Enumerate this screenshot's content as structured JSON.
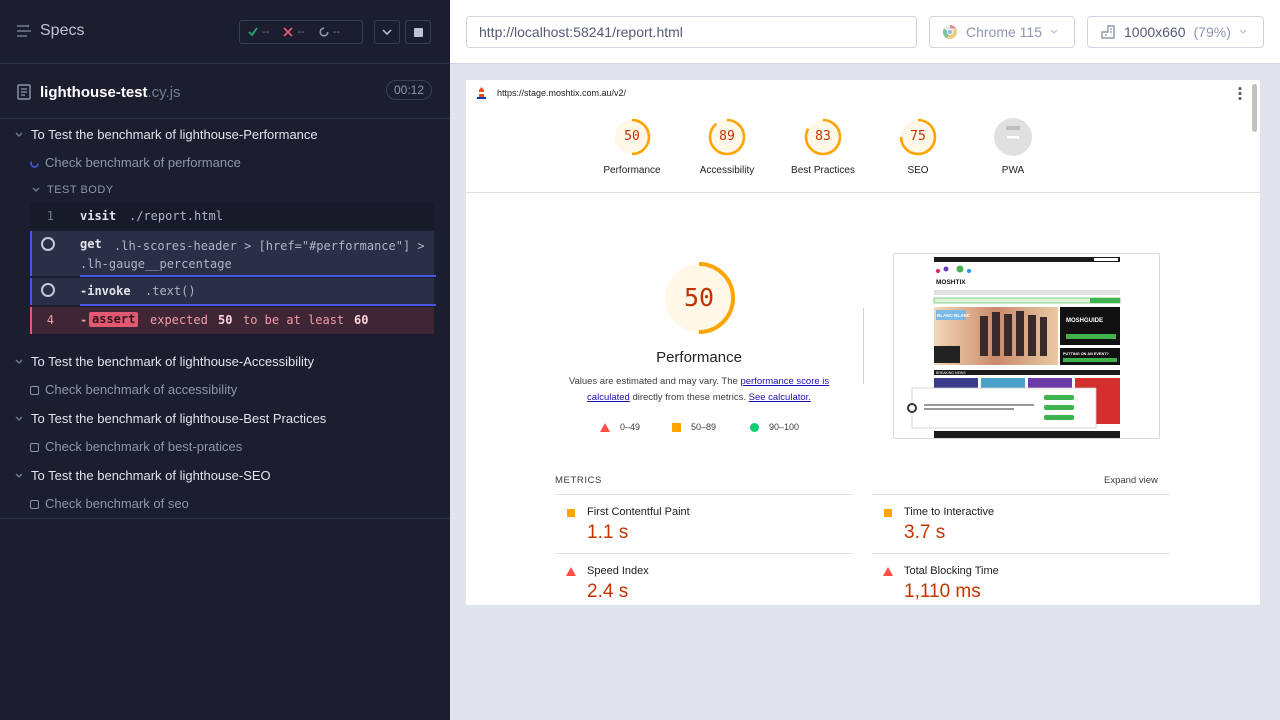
{
  "runner": {
    "specs_label": "Specs",
    "stats": {
      "passed": "--",
      "failed": "--",
      "pending": "--"
    },
    "file": {
      "name": "lighthouse-test",
      "ext": ".cy.js",
      "duration": "00:12"
    },
    "suites": [
      {
        "title": "To Test the benchmark of lighthouse-Performance",
        "test": "Check benchmark of performance",
        "test_body_label": "TEST BODY",
        "commands": [
          {
            "num": "1",
            "name": "visit",
            "arg": "./report.html"
          },
          {
            "name": "get",
            "arg": ".lh-scores-header > [href=\"#performance\"] > .lh-gauge__percentage"
          },
          {
            "name": "-invoke",
            "arg": ".text()"
          },
          {
            "num": "4",
            "prefix": "-",
            "name": "assert",
            "msg": [
              "expected",
              "50",
              "to be at least",
              "60"
            ]
          }
        ]
      },
      {
        "title": "To Test the benchmark of lighthouse-Accessibility",
        "test": "Check benchmark of accessibility"
      },
      {
        "title": "To Test the benchmark of lighthouse-Best Practices",
        "test": "Check benchmark of best-pratices"
      },
      {
        "title": "To Test the benchmark of lighthouse-SEO",
        "test": "Check benchmark of seo"
      }
    ]
  },
  "toolbar": {
    "url": "http://localhost:58241/report.html",
    "browser": "Chrome 115",
    "viewport": "1000x660",
    "scale": "(79%)"
  },
  "report": {
    "page_url": "https://stage.moshtix.com.au/v2/",
    "scores": [
      {
        "label": "Performance",
        "value": "50",
        "color": "#ffa400",
        "fraction": 0.5
      },
      {
        "label": "Accessibility",
        "value": "89",
        "color": "#ffa400",
        "fraction": 0.89
      },
      {
        "label": "Best Practices",
        "value": "83",
        "color": "#ffa400",
        "fraction": 0.83
      },
      {
        "label": "SEO",
        "value": "75",
        "color": "#ffa400",
        "fraction": 0.75
      },
      {
        "label": "PWA",
        "value": "",
        "color": "#cccccc",
        "fraction": 0
      }
    ],
    "perf": {
      "value": "50",
      "title": "Performance",
      "desc_1": "Values are estimated and may vary. The ",
      "desc_link_1": "performance score is calculated",
      "desc_2": " directly from these metrics. ",
      "desc_link_2": "See calculator.",
      "legend": [
        "0–49",
        "50–89",
        "90–100"
      ]
    },
    "metrics_label": "METRICS",
    "expand_label": "Expand view",
    "metrics": [
      {
        "title": "First Contentful Paint",
        "value": "1.1 s",
        "rating": "average"
      },
      {
        "title": "Time to Interactive",
        "value": "3.7 s",
        "rating": "average"
      },
      {
        "title": "Speed Index",
        "value": "2.4 s",
        "rating": "fail"
      },
      {
        "title": "Total Blocking Time",
        "value": "1,110 ms",
        "rating": "fail"
      }
    ],
    "thumb": {
      "brand": "MOSHTIX",
      "promo": "MOSHGUIDE",
      "promo2": "PUTTING ON AN EVENT?",
      "section": "BREAKING NEWS",
      "band": "BLANC-BLANC"
    },
    "colors": {
      "fail": "#ff4e42",
      "average": "#ffa400",
      "pass": "#0cce6b",
      "score_text": "#c33300"
    }
  }
}
